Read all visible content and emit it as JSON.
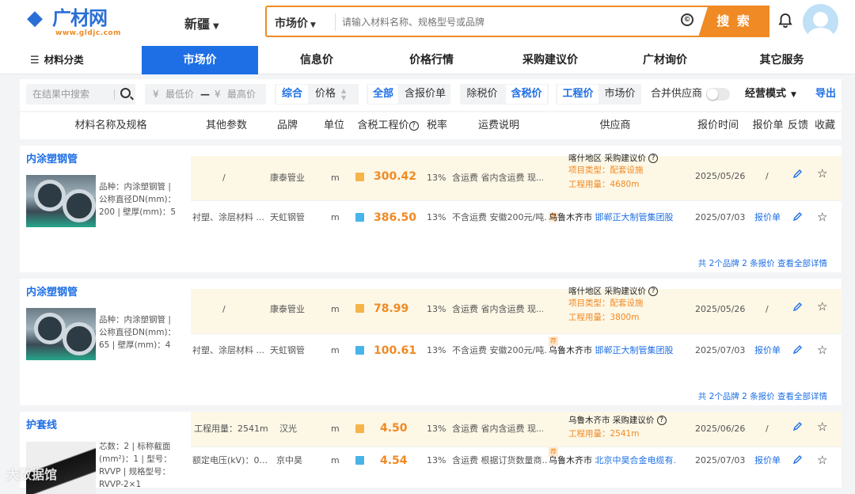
{
  "header": {
    "logo_text": "广材网",
    "logo_url": "www.gldjc.com",
    "region": "新疆",
    "search_mode": "市场价",
    "search_placeholder": "请输入材料名称、规格型号或品牌",
    "search_button": "搜 索",
    "camera_glyph": "©"
  },
  "nav": [
    {
      "label": "材料分类"
    },
    {
      "label": "市场价"
    },
    {
      "label": "信息价"
    },
    {
      "label": "价格行情"
    },
    {
      "label": "采购建议价"
    },
    {
      "label": "广材询价"
    },
    {
      "label": "其它服务"
    }
  ],
  "filters": {
    "search_placeholder": "在结果中搜索",
    "min_price": "最低价",
    "max_price": "最高价",
    "currency": "¥",
    "dash": "—",
    "sort": [
      "综合",
      "价格"
    ],
    "type": [
      "全部",
      "含报价单"
    ],
    "tax": [
      "除税价",
      "含税价"
    ],
    "price_kind": [
      "工程价",
      "市场价"
    ],
    "merge_label": "合并供应商",
    "mode_label": "经营模式",
    "export_label": "导出"
  },
  "columns": [
    "材料名称及规格",
    "其他参数",
    "品牌",
    "单位",
    "含税工程价",
    "税率",
    "运费说明",
    "供应商",
    "报价时间",
    "报价单",
    "反馈",
    "收藏"
  ],
  "products": [
    {
      "name": "内涂塑钢管",
      "spec": "品种：内涂塑钢管 | 公称直径DN(mm)：200 | 壁厚(mm)：5",
      "summary": "共 2个品牌 2 条报价 查看全部详情",
      "rows": [
        {
          "param": "/",
          "brand": "康泰管业",
          "unit": "m",
          "price": "300.42",
          "tax": "13%",
          "freight": "含运费 省内含运费 现...",
          "sup_line1": "喀什地区 采购建议价",
          "sup_line2_label": "项目类型：",
          "sup_line2_val": "配套设施",
          "sup_line3_label": "工程用量：",
          "sup_line3_val": "4680m",
          "date": "2025/05/26",
          "quote": "/"
        },
        {
          "param": "衬塑、涂层材料 ...",
          "brand": "天虹钢管",
          "unit": "m",
          "price": "386.50",
          "tax": "13%",
          "freight": "不含运费 安徽200元/吨...",
          "sup_city": "乌鲁木齐市",
          "sup_name": "邯郸正大制管集团股...",
          "date": "2025/07/03",
          "quote": "报价单"
        }
      ]
    },
    {
      "name": "内涂塑钢管",
      "spec": "品种：内涂塑钢管 | 公称直径DN(mm)：65 | 壁厚(mm)：4",
      "summary": "共 2个品牌 2 条报价 查看全部详情",
      "rows": [
        {
          "param": "/",
          "brand": "康泰管业",
          "unit": "m",
          "price": "78.99",
          "tax": "13%",
          "freight": "含运费 省内含运费 现...",
          "sup_line1": "喀什地区 采购建议价",
          "sup_line2_label": "项目类型：",
          "sup_line2_val": "配套设施",
          "sup_line3_label": "工程用量：",
          "sup_line3_val": "3800m",
          "date": "2025/05/26",
          "quote": "/"
        },
        {
          "param": "衬塑、涂层材料 ...",
          "brand": "天虹钢管",
          "unit": "m",
          "price": "100.61",
          "tax": "13%",
          "freight": "不含运费 安徽200元/吨...",
          "sup_city": "乌鲁木齐市",
          "sup_name": "邯郸正大制管集团股...",
          "date": "2025/07/03",
          "quote": "报价单"
        }
      ]
    },
    {
      "name": "护套线",
      "spec": "芯数：2 | 标称截面(mm²)：1 | 型号：RVVP | 规格型号：RVVP-2×1",
      "rows": [
        {
          "param": "工程用量：2541m",
          "brand": "汉光",
          "unit": "m",
          "price": "4.50",
          "tax": "13%",
          "freight": "含运费 省内含运费 现...",
          "sup_line1": "乌鲁木齐市 采购建议价",
          "sup_line2_label": "工程用量：",
          "sup_line2_val": "2541m",
          "date": "2025/06/26",
          "quote": "/"
        },
        {
          "param": "额定电压(kV)：0...",
          "brand": "京中昊",
          "unit": "m",
          "price": "4.54",
          "tax": "13%",
          "freight": "含运费 根据订货数量商...",
          "sup_city": "乌鲁木齐市",
          "sup_name": "北京中昊合金电缆有...",
          "date": "2025/07/03",
          "quote": "报价单"
        }
      ]
    }
  ],
  "tag_char": "荐",
  "question_glyph": "?",
  "star_glyph": "☆",
  "watermark": "大数据馆"
}
